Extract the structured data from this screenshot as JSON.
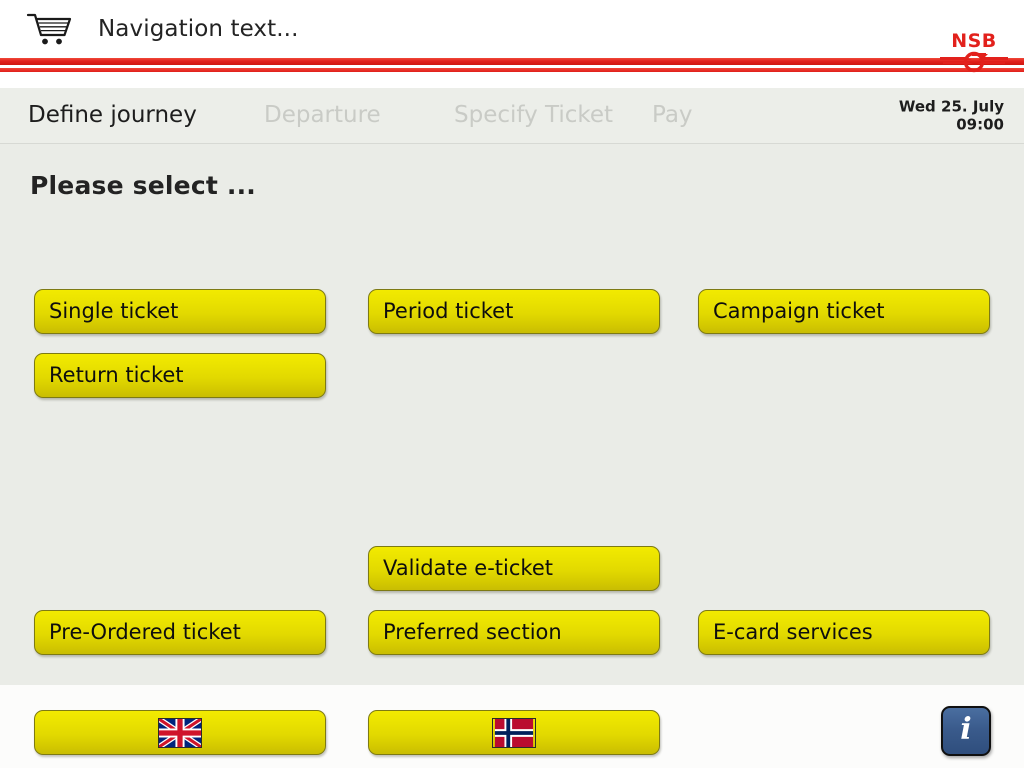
{
  "header": {
    "cart_icon": "shopping-cart-icon",
    "navigation_text": "Navigation text...",
    "logo_text": "NSB",
    "logo_color": "#e2211c",
    "rule_color": "#e2211c"
  },
  "tabs": [
    {
      "label": "Define journey",
      "active": true
    },
    {
      "label": "Departure",
      "active": false
    },
    {
      "label": "Specify Ticket",
      "active": false
    },
    {
      "label": "Pay",
      "active": false
    }
  ],
  "datetime": {
    "date": "Wed 25. July",
    "time": "09:00"
  },
  "main": {
    "title": "Please select ...",
    "background": "#eaece7",
    "buttons": [
      {
        "label": "Single ticket",
        "col": 1,
        "row": 1
      },
      {
        "label": "Period ticket",
        "col": 2,
        "row": 1
      },
      {
        "label": "Campaign ticket",
        "col": 3,
        "row": 1
      },
      {
        "label": "Return ticket",
        "col": 1,
        "row": 2
      },
      {
        "label": "Validate e-ticket",
        "col": 2,
        "row": 3
      },
      {
        "label": "Pre-Ordered ticket",
        "col": 1,
        "row": 4
      },
      {
        "label": "Preferred section",
        "col": 2,
        "row": 4
      },
      {
        "label": "E-card services",
        "col": 3,
        "row": 4
      }
    ],
    "button_color": "#e8e000"
  },
  "footer": {
    "languages": [
      {
        "name": "english",
        "flag": "union-jack-flag"
      },
      {
        "name": "norwegian",
        "flag": "norway-flag"
      }
    ],
    "info_glyph": "i",
    "info_color": "#3a5b8c"
  }
}
